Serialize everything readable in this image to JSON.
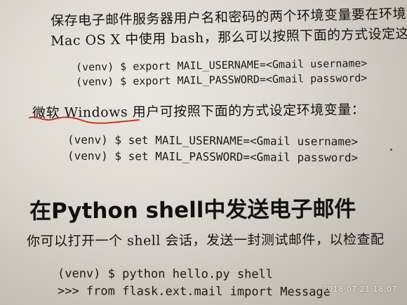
{
  "text_lines": [
    "保存电子邮件服务器用户名和密码的两个环境变量要在环境",
    "Mac OS X 中使用 bash，那么可以按照下面的方式设定这两个",
    "(venv) $ export MAIL_USERNAME=<Gmail username>",
    "(venv) $ export MAIL_PASSWORD=<Gmail password>",
    "微软 Windows 用户可按照下面的方式设定环境变量：",
    "(venv) $ set MAIL_USERNAME=<Gmail username>",
    "(venv) $ set MAIL_PASSWORD=<Gmail password>",
    "在Python shell中发送电子邮件",
    "你可以打开一个 shell 会话，发送一封测试邮件，以检查配",
    "(venv) $ python hello.py shell",
    ">>> from flask.ext.mail import Message"
  ],
  "timestamp": "2018·07·21  18:07",
  "colors": {
    "underline": "#c0392b",
    "ink": "#141414"
  }
}
